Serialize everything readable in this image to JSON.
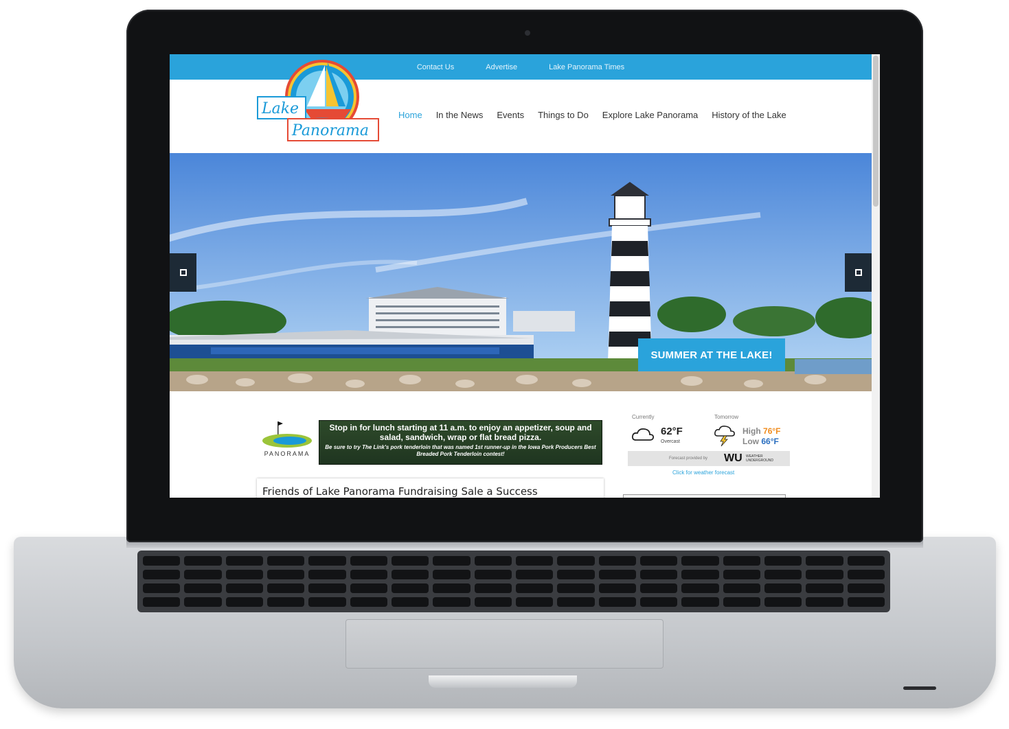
{
  "topbar": {
    "links": [
      "Contact Us",
      "Advertise",
      "Lake Panorama Times"
    ]
  },
  "logo": {
    "text_line1": "Lake",
    "text_line2": "Panorama"
  },
  "nav": {
    "items": [
      "Home",
      "In the News",
      "Events",
      "Things to Do",
      "Explore Lake Panorama",
      "History of the Lake"
    ],
    "active": "Home"
  },
  "hero": {
    "caption": "SUMMER AT THE LAKE!"
  },
  "ad": {
    "logo_text": "PANORAMA",
    "line1": "Stop in for lunch starting at 11 a.m. to enjoy an appetizer, soup and salad, sandwich, wrap or flat bread pizza.",
    "line2": "Be sure to try The Link's pork tenderloin that was named 1st runner-up in the Iowa Pork Producers Best Breaded Pork Tenderloin contest!"
  },
  "weather": {
    "current_label": "Currently",
    "tomorrow_label": "Tomorrow",
    "current_temp": "62°F",
    "current_condition": "Overcast",
    "high_label": "High",
    "high_value": "76°F",
    "low_label": "Low",
    "low_value": "66°F",
    "provided_by": "Forecast provided by",
    "wu_logo": "WU",
    "wu_sub": "WEATHER UNDERGROUND",
    "forecast_link": "Click for weather forecast",
    "current_icon": "cloud-icon",
    "tomorrow_icon": "thunderstorm-icon"
  },
  "article": {
    "title": "Friends of Lake Panorama Fundraising Sale a Success"
  },
  "colors": {
    "accent": "#2aa3db",
    "high": "#f08c1e",
    "low": "#2b6fc0"
  }
}
